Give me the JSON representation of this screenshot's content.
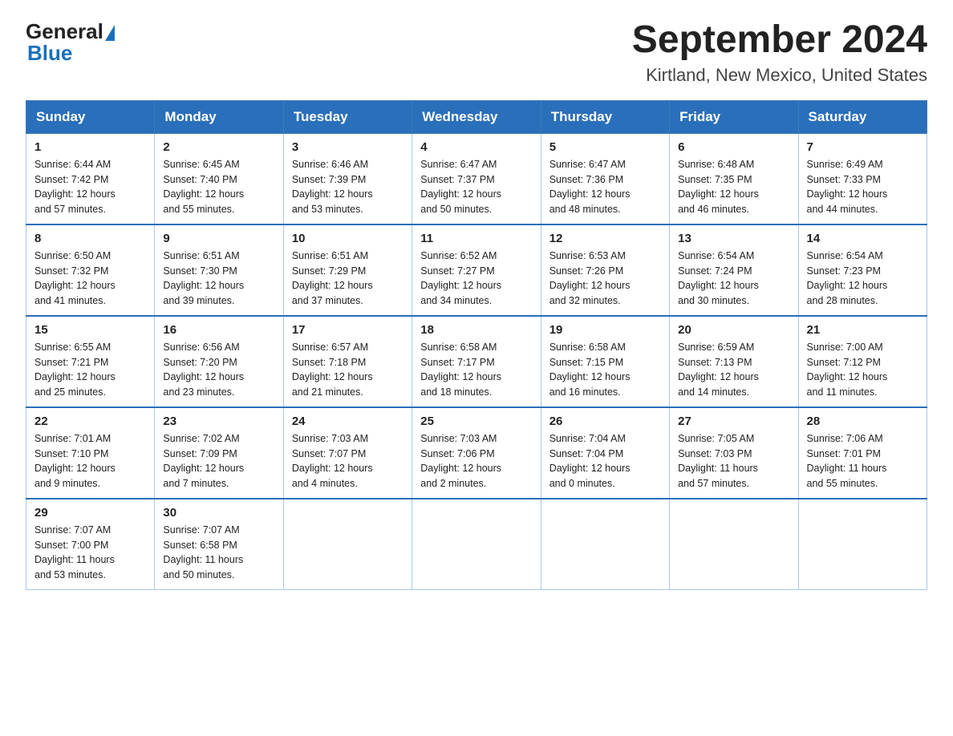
{
  "logo": {
    "general_text": "General",
    "blue_text": "Blue"
  },
  "title": "September 2024",
  "subtitle": "Kirtland, New Mexico, United States",
  "days_of_week": [
    "Sunday",
    "Monday",
    "Tuesday",
    "Wednesday",
    "Thursday",
    "Friday",
    "Saturday"
  ],
  "weeks": [
    [
      {
        "day": "1",
        "sunrise": "6:44 AM",
        "sunset": "7:42 PM",
        "daylight": "12 hours and 57 minutes."
      },
      {
        "day": "2",
        "sunrise": "6:45 AM",
        "sunset": "7:40 PM",
        "daylight": "12 hours and 55 minutes."
      },
      {
        "day": "3",
        "sunrise": "6:46 AM",
        "sunset": "7:39 PM",
        "daylight": "12 hours and 53 minutes."
      },
      {
        "day": "4",
        "sunrise": "6:47 AM",
        "sunset": "7:37 PM",
        "daylight": "12 hours and 50 minutes."
      },
      {
        "day": "5",
        "sunrise": "6:47 AM",
        "sunset": "7:36 PM",
        "daylight": "12 hours and 48 minutes."
      },
      {
        "day": "6",
        "sunrise": "6:48 AM",
        "sunset": "7:35 PM",
        "daylight": "12 hours and 46 minutes."
      },
      {
        "day": "7",
        "sunrise": "6:49 AM",
        "sunset": "7:33 PM",
        "daylight": "12 hours and 44 minutes."
      }
    ],
    [
      {
        "day": "8",
        "sunrise": "6:50 AM",
        "sunset": "7:32 PM",
        "daylight": "12 hours and 41 minutes."
      },
      {
        "day": "9",
        "sunrise": "6:51 AM",
        "sunset": "7:30 PM",
        "daylight": "12 hours and 39 minutes."
      },
      {
        "day": "10",
        "sunrise": "6:51 AM",
        "sunset": "7:29 PM",
        "daylight": "12 hours and 37 minutes."
      },
      {
        "day": "11",
        "sunrise": "6:52 AM",
        "sunset": "7:27 PM",
        "daylight": "12 hours and 34 minutes."
      },
      {
        "day": "12",
        "sunrise": "6:53 AM",
        "sunset": "7:26 PM",
        "daylight": "12 hours and 32 minutes."
      },
      {
        "day": "13",
        "sunrise": "6:54 AM",
        "sunset": "7:24 PM",
        "daylight": "12 hours and 30 minutes."
      },
      {
        "day": "14",
        "sunrise": "6:54 AM",
        "sunset": "7:23 PM",
        "daylight": "12 hours and 28 minutes."
      }
    ],
    [
      {
        "day": "15",
        "sunrise": "6:55 AM",
        "sunset": "7:21 PM",
        "daylight": "12 hours and 25 minutes."
      },
      {
        "day": "16",
        "sunrise": "6:56 AM",
        "sunset": "7:20 PM",
        "daylight": "12 hours and 23 minutes."
      },
      {
        "day": "17",
        "sunrise": "6:57 AM",
        "sunset": "7:18 PM",
        "daylight": "12 hours and 21 minutes."
      },
      {
        "day": "18",
        "sunrise": "6:58 AM",
        "sunset": "7:17 PM",
        "daylight": "12 hours and 18 minutes."
      },
      {
        "day": "19",
        "sunrise": "6:58 AM",
        "sunset": "7:15 PM",
        "daylight": "12 hours and 16 minutes."
      },
      {
        "day": "20",
        "sunrise": "6:59 AM",
        "sunset": "7:13 PM",
        "daylight": "12 hours and 14 minutes."
      },
      {
        "day": "21",
        "sunrise": "7:00 AM",
        "sunset": "7:12 PM",
        "daylight": "12 hours and 11 minutes."
      }
    ],
    [
      {
        "day": "22",
        "sunrise": "7:01 AM",
        "sunset": "7:10 PM",
        "daylight": "12 hours and 9 minutes."
      },
      {
        "day": "23",
        "sunrise": "7:02 AM",
        "sunset": "7:09 PM",
        "daylight": "12 hours and 7 minutes."
      },
      {
        "day": "24",
        "sunrise": "7:03 AM",
        "sunset": "7:07 PM",
        "daylight": "12 hours and 4 minutes."
      },
      {
        "day": "25",
        "sunrise": "7:03 AM",
        "sunset": "7:06 PM",
        "daylight": "12 hours and 2 minutes."
      },
      {
        "day": "26",
        "sunrise": "7:04 AM",
        "sunset": "7:04 PM",
        "daylight": "12 hours and 0 minutes."
      },
      {
        "day": "27",
        "sunrise": "7:05 AM",
        "sunset": "7:03 PM",
        "daylight": "11 hours and 57 minutes."
      },
      {
        "day": "28",
        "sunrise": "7:06 AM",
        "sunset": "7:01 PM",
        "daylight": "11 hours and 55 minutes."
      }
    ],
    [
      {
        "day": "29",
        "sunrise": "7:07 AM",
        "sunset": "7:00 PM",
        "daylight": "11 hours and 53 minutes."
      },
      {
        "day": "30",
        "sunrise": "7:07 AM",
        "sunset": "6:58 PM",
        "daylight": "11 hours and 50 minutes."
      },
      null,
      null,
      null,
      null,
      null
    ]
  ],
  "labels": {
    "sunrise": "Sunrise: ",
    "sunset": "Sunset: ",
    "daylight": "Daylight: "
  }
}
